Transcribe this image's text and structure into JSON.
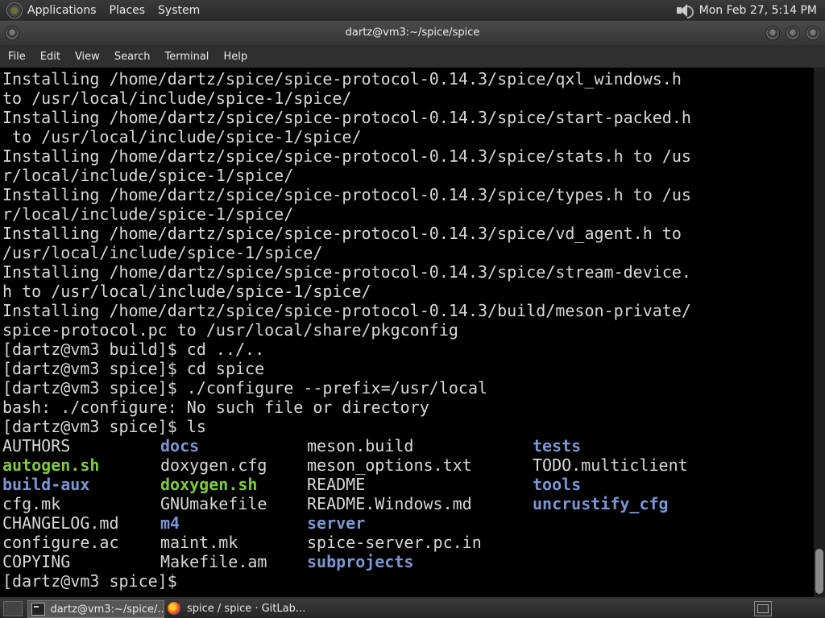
{
  "top_panel": {
    "menus": [
      "Applications",
      "Places",
      "System"
    ],
    "clock": "Mon Feb 27,  5:14 PM"
  },
  "window": {
    "title": "dartz@vm3:~/spice/spice"
  },
  "menubar": [
    "File",
    "Edit",
    "View",
    "Search",
    "Terminal",
    "Help"
  ],
  "terminal": {
    "lines": [
      "Installing /home/dartz/spice/spice-protocol-0.14.3/spice/qxl_windows.h",
      "to /usr/local/include/spice-1/spice/",
      "Installing /home/dartz/spice/spice-protocol-0.14.3/spice/start-packed.h",
      " to /usr/local/include/spice-1/spice/",
      "Installing /home/dartz/spice/spice-protocol-0.14.3/spice/stats.h to /us",
      "r/local/include/spice-1/spice/",
      "Installing /home/dartz/spice/spice-protocol-0.14.3/spice/types.h to /us",
      "r/local/include/spice-1/spice/",
      "Installing /home/dartz/spice/spice-protocol-0.14.3/spice/vd_agent.h to",
      "/usr/local/include/spice-1/spice/",
      "Installing /home/dartz/spice/spice-protocol-0.14.3/spice/stream-device.",
      "h to /usr/local/include/spice-1/spice/",
      "Installing /home/dartz/spice/spice-protocol-0.14.3/build/meson-private/",
      "spice-protocol.pc to /usr/local/share/pkgconfig",
      "[dartz@vm3 build]$ cd ../..",
      "[dartz@vm3 spice]$ cd spice",
      "[dartz@vm3 spice]$ ./configure --prefix=/usr/local",
      "bash: ./configure: No such file or directory",
      "[dartz@vm3 spice]$ ls"
    ],
    "ls_rows": [
      [
        {
          "t": "AUTHORS",
          "k": "file"
        },
        {
          "t": "docs",
          "k": "dir"
        },
        {
          "t": "meson.build",
          "k": "file"
        },
        {
          "t": "tests",
          "k": "dir"
        }
      ],
      [
        {
          "t": "autogen.sh",
          "k": "exe"
        },
        {
          "t": "doxygen.cfg",
          "k": "file"
        },
        {
          "t": "meson_options.txt",
          "k": "file"
        },
        {
          "t": "TODO.multiclient",
          "k": "file"
        }
      ],
      [
        {
          "t": "build-aux",
          "k": "dir"
        },
        {
          "t": "doxygen.sh",
          "k": "exe"
        },
        {
          "t": "README",
          "k": "file"
        },
        {
          "t": "tools",
          "k": "dir"
        }
      ],
      [
        {
          "t": "cfg.mk",
          "k": "file"
        },
        {
          "t": "GNUmakefile",
          "k": "file"
        },
        {
          "t": "README.Windows.md",
          "k": "file"
        },
        {
          "t": "uncrustify_cfg",
          "k": "dir"
        }
      ],
      [
        {
          "t": "CHANGELOG.md",
          "k": "file"
        },
        {
          "t": "m4",
          "k": "dir"
        },
        {
          "t": "server",
          "k": "dir"
        },
        {
          "t": "",
          "k": "file"
        }
      ],
      [
        {
          "t": "configure.ac",
          "k": "file"
        },
        {
          "t": "maint.mk",
          "k": "file"
        },
        {
          "t": "spice-server.pc.in",
          "k": "file"
        },
        {
          "t": "",
          "k": "file"
        }
      ],
      [
        {
          "t": "COPYING",
          "k": "file"
        },
        {
          "t": "Makefile.am",
          "k": "file"
        },
        {
          "t": "subprojects",
          "k": "dir"
        },
        {
          "t": "",
          "k": "file"
        }
      ]
    ],
    "final_prompt": "[dartz@vm3 spice]$ "
  },
  "taskbar": {
    "tasks": [
      "dartz@vm3:~/spice/...",
      "spice / spice · GitLab..."
    ]
  },
  "icons": {
    "panel_logo": "distro-logo-icon",
    "volume": "speaker-icon",
    "show_desktop": "show-desktop-icon",
    "terminal_task": "terminal-icon",
    "browser_task": "firefox-icon",
    "workspace": "workspace-switcher-icon"
  }
}
